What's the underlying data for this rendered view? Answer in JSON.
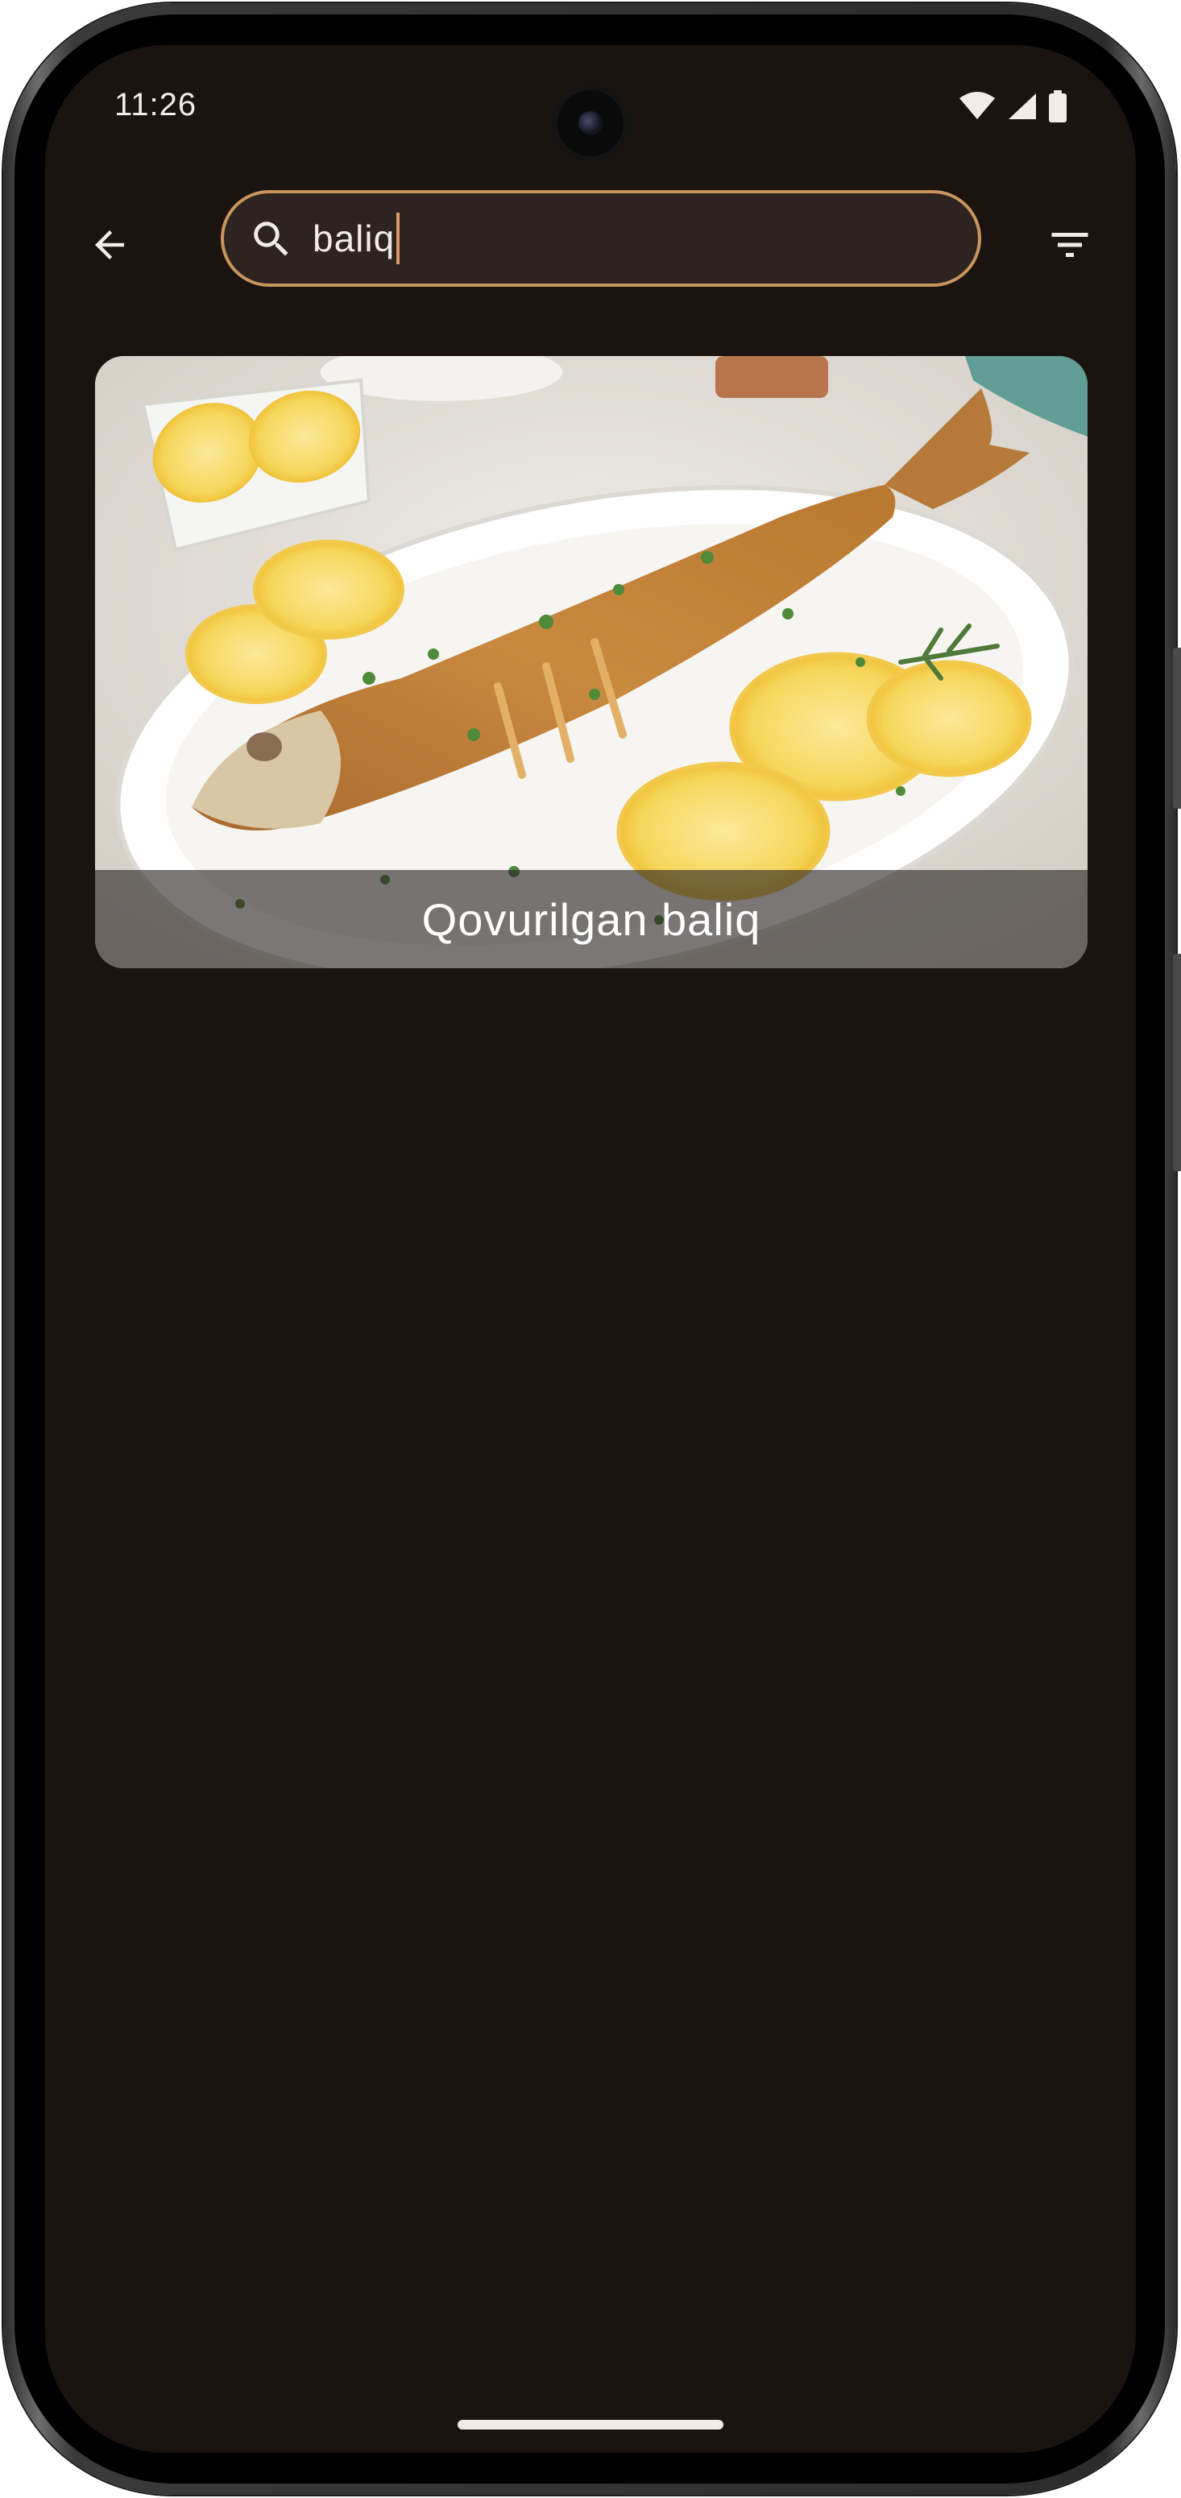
{
  "status_bar": {
    "time": "11:26",
    "icons": [
      "wifi-icon",
      "signal-icon",
      "battery-icon"
    ]
  },
  "top_bar": {
    "back_icon": "arrow-left-icon",
    "search": {
      "icon": "search-icon",
      "value": "baliq"
    },
    "filter_icon": "filter-icon"
  },
  "results": [
    {
      "title": "Qovurilgan baliq",
      "image": "fried-fish-with-lemon-photo"
    }
  ],
  "colors": {
    "background": "#1b1310",
    "search_border": "#c8955e",
    "search_fill": "#2d2421",
    "text": "#efe6e0"
  }
}
